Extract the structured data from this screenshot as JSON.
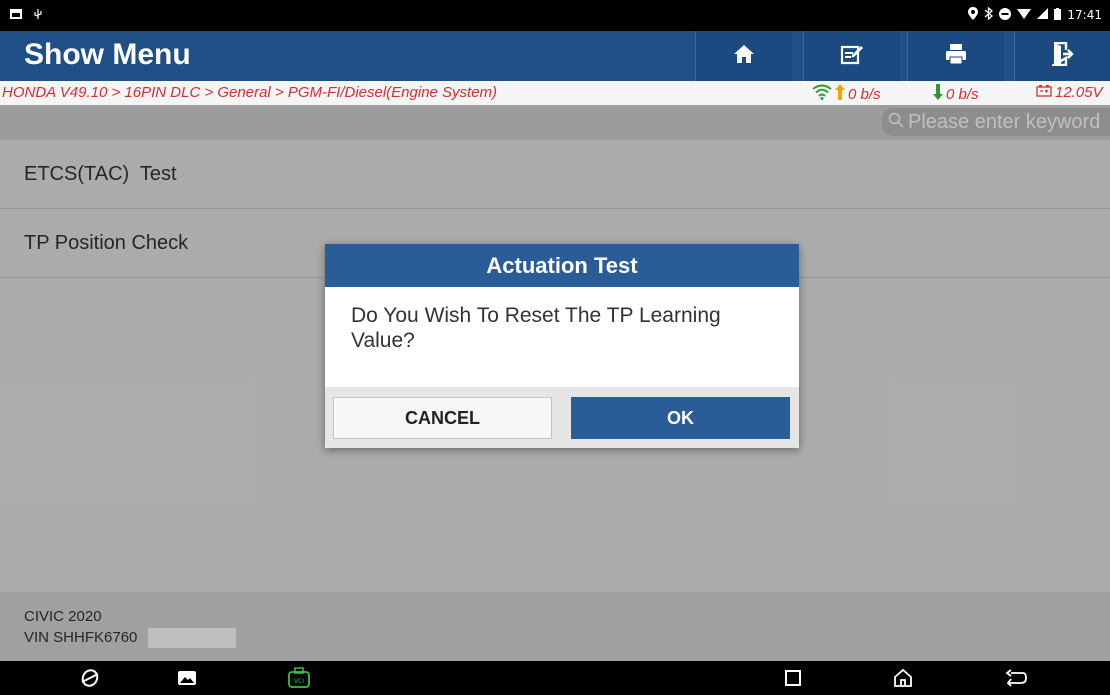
{
  "status_bar": {
    "time": "17:41"
  },
  "header": {
    "title": "Show Menu",
    "buttons": [
      "home-icon",
      "edit-icon",
      "print-icon",
      "exit-icon"
    ]
  },
  "breadcrumb": {
    "path": "HONDA V49.10 > 16PIN DLC > General > PGM-FI/Diesel(Engine System)",
    "upload_speed": "0 b/s",
    "download_speed": "0 b/s",
    "voltage": "12.05V"
  },
  "search": {
    "placeholder": "Please enter keyword"
  },
  "menu": {
    "items": [
      {
        "label": "ETCS(TAC)  Test"
      },
      {
        "label": "TP Position Check"
      }
    ]
  },
  "footer": {
    "model": "CIVIC 2020",
    "vin": "VIN SHHFK6760"
  },
  "dialog": {
    "title": "Actuation Test",
    "message": "Do You Wish To Reset The TP Learning Value?",
    "cancel_label": "CANCEL",
    "ok_label": "OK"
  },
  "colors": {
    "header": "#1f4f86",
    "dialog_title": "#2a5d98",
    "breadcrumb_text": "#d32f2f",
    "upload_arrow": "#f2a400",
    "download_arrow": "#2e9a2e"
  }
}
